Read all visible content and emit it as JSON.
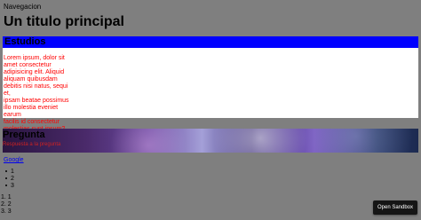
{
  "nav": {
    "label": "Navegacion"
  },
  "title": "Un titulo principal",
  "section1": {
    "heading": "Estudios",
    "body": "Lorem ipsum, dolor sit\namet consectetur\nadipisicing elit. Aliquid\naliquam quibusdam\ndebitis nisi natus, sequi et,\nipsam beatae possimus\nillo molestia eveniet earum\nfacilis id consectetur\nmolestias sunt ipsum?\nNisi."
  },
  "section2": {
    "heading": "Pregunta",
    "subtext": "Respuesta a la pregunta"
  },
  "link": {
    "label": "Google"
  },
  "unordered_list": [
    "1",
    "2",
    "3"
  ],
  "ordered_list": [
    "1",
    "2",
    "3"
  ],
  "open_sandbox": {
    "label": "Open Sandbox"
  },
  "colors": {
    "background": "#7f7f7f",
    "section_header": "#0000ff",
    "body_text": "#ff0000",
    "button_bg": "#151515"
  }
}
